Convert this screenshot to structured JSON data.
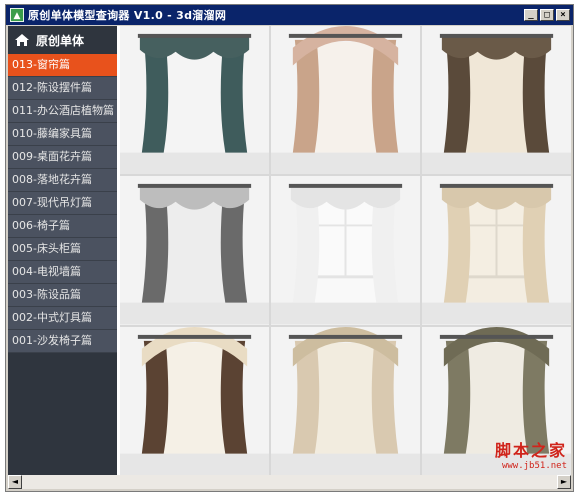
{
  "window": {
    "title": "原创单体模型查询器 V1.0 - 3d溜溜网",
    "minimize_label": "_",
    "maximize_label": "□",
    "close_label": "×"
  },
  "sidebar": {
    "header": "原创单体",
    "items": [
      {
        "label": "013-窗帘篇",
        "active": true
      },
      {
        "label": "012-陈设摆件篇",
        "active": false
      },
      {
        "label": "011-办公酒店植物篇",
        "active": false
      },
      {
        "label": "010-藤编家具篇",
        "active": false
      },
      {
        "label": "009-桌面花卉篇",
        "active": false
      },
      {
        "label": "008-落地花卉篇",
        "active": false
      },
      {
        "label": "007-现代吊灯篇",
        "active": false
      },
      {
        "label": "006-椅子篇",
        "active": false
      },
      {
        "label": "005-床头柜篇",
        "active": false
      },
      {
        "label": "004-电视墙篇",
        "active": false
      },
      {
        "label": "003-陈设品篇",
        "active": false
      },
      {
        "label": "002-中式灯具篇",
        "active": false
      },
      {
        "label": "001-沙发椅子篇",
        "active": false
      }
    ]
  },
  "thumbnails": [
    {
      "name": "curtain-dark-teal-swag",
      "colors": {
        "drape": "#3f5c5c",
        "valance": "#46605f",
        "sheer": "#f4f4f4"
      }
    },
    {
      "name": "curtain-arched-beige-pink",
      "colors": {
        "drape": "#c9a48a",
        "valance": "#d6b3a0",
        "sheer": "#f6f1ea"
      }
    },
    {
      "name": "curtain-brown-cream-sheer",
      "colors": {
        "drape": "#5a4a3a",
        "valance": "#6a5a48",
        "sheer": "#efe6d4"
      }
    },
    {
      "name": "curtain-grey-white-lace",
      "colors": {
        "drape": "#6a6a6a",
        "valance": "#bdbdbd",
        "sheer": "#ececec"
      }
    },
    {
      "name": "curtain-white-sheer-window",
      "colors": {
        "drape": "#f0f0f0",
        "valance": "#e4e4e4",
        "sheer": "#fafafa"
      }
    },
    {
      "name": "curtain-beige-tied-window",
      "colors": {
        "drape": "#e0d0b4",
        "valance": "#d8c8ac",
        "sheer": "#f3ecdf"
      }
    },
    {
      "name": "curtain-floral-brown-arch",
      "colors": {
        "drape": "#5b4333",
        "valance": "#e9dcc4",
        "sheer": "#f5efe4"
      }
    },
    {
      "name": "curtain-arched-cream",
      "colors": {
        "drape": "#d9c9b0",
        "valance": "#cdbd9f",
        "sheer": "#f2ebdd"
      }
    },
    {
      "name": "curtain-arched-olive",
      "colors": {
        "drape": "#7e7a63",
        "valance": "#6f6b55",
        "sheer": "#eeeae0"
      }
    }
  ],
  "watermark": {
    "main": "脚本之家",
    "url": "www.jb51.net",
    "color": "#d0241b"
  },
  "colors": {
    "titlebar": "#0a246a",
    "sidebar_bg": "#2f353e",
    "nav_item_bg": "#4b5260",
    "active_item": "#e8521c"
  }
}
